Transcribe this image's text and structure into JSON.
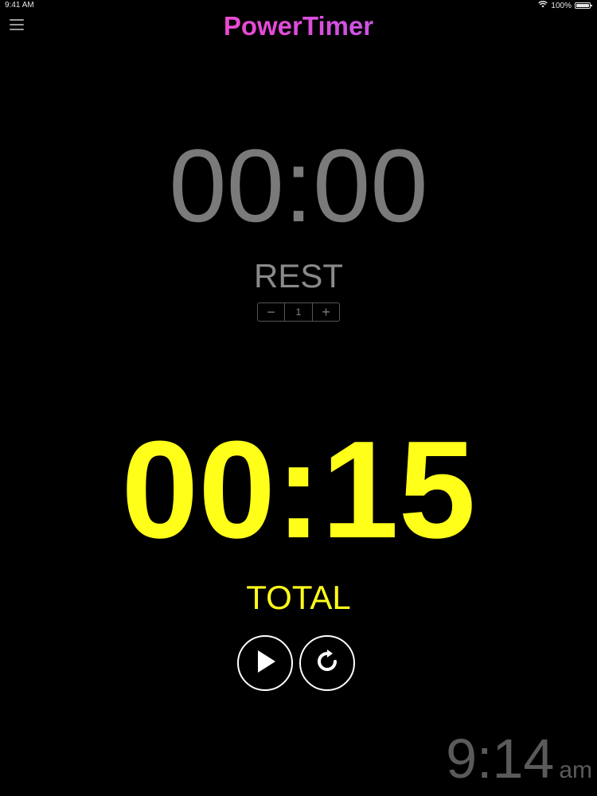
{
  "status_bar": {
    "time": "9:41 AM",
    "battery": "100%",
    "wifi_icon": "wifi-icon",
    "battery_icon": "battery-icon"
  },
  "header": {
    "menu_icon": "hamburger-menu-icon",
    "title": "PowerTimer",
    "title_colors": [
      "#ff4fa0",
      "#e34ad8",
      "#9b6bff"
    ]
  },
  "rest": {
    "time": "00:00",
    "label": "REST",
    "stepper": {
      "decrement": "−",
      "value": "1",
      "increment": "+"
    },
    "color": "#7a7a7a"
  },
  "total": {
    "time": "00:15",
    "label": "TOTAL",
    "color": "#ffff1a"
  },
  "controls": {
    "play_icon": "play-icon",
    "reset_icon": "reset-icon"
  },
  "clock": {
    "time": "9:14",
    "ampm": "am"
  }
}
